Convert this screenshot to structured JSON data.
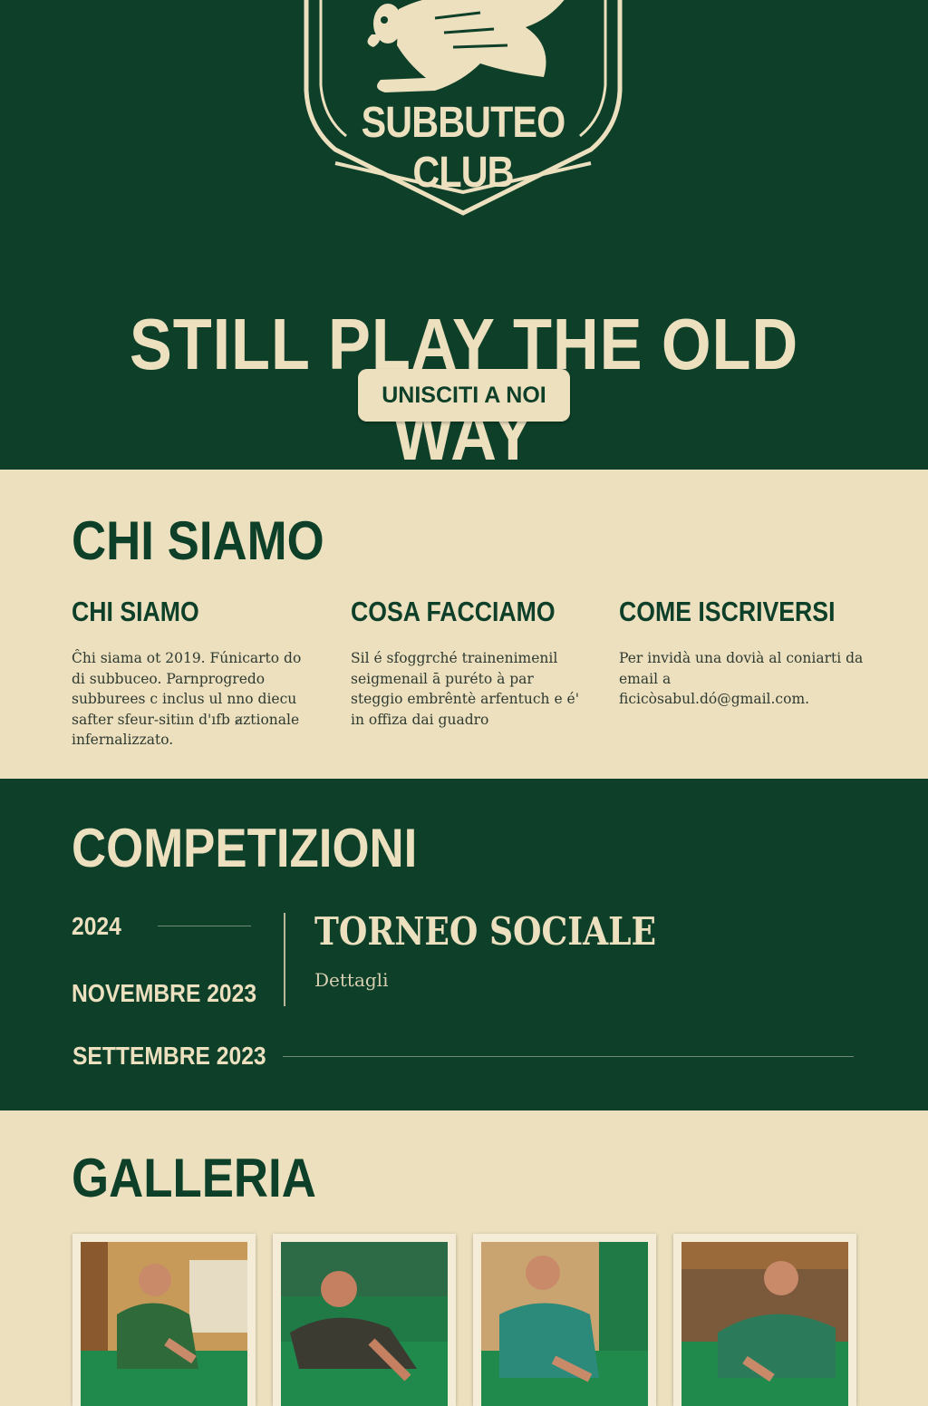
{
  "hero": {
    "crest_text": "SUBBUTEO CLUB",
    "title": "STILL PLAY THE OLD WAY",
    "join_button": "UNISCITI A NOI"
  },
  "about": {
    "title": "CHI SIAMO",
    "columns": [
      {
        "heading": "CHI SIAMO",
        "text": "Ĉhi siama ot 2019. Fúnicarto do di subbuceo. Parnprogredo subburees c inclus ul nno diecu safter sfeur-sitiın d'ıfb a̷ztionale infernalizzato."
      },
      {
        "heading": "COSA FACCIAMO",
        "text": "Sil é sfoggrché trainenimenil seigmenail ā puréto à par steggio embrêntè arfentuch e é' in offiza dai guadro"
      },
      {
        "heading": "COME ISCRIVERSI",
        "text": "Per invidà una dovià al coniarti da email a ficicòsabul.dó@gmail.com."
      }
    ]
  },
  "competitions": {
    "title": "COMPETIZIONI",
    "dates": [
      "2024",
      "NOVEMBRE 2023",
      "SETTEMBRE 2023"
    ],
    "event_title": "TORNEO SOCIALE",
    "event_link": "Dettagli"
  },
  "gallery": {
    "title": "GALLERIA",
    "photos": [
      "photo-1",
      "photo-2",
      "photo-3",
      "photo-4"
    ]
  },
  "colors": {
    "green": "#0d3f29",
    "cream": "#ece0bf",
    "table_green": "#1f8a4c"
  }
}
